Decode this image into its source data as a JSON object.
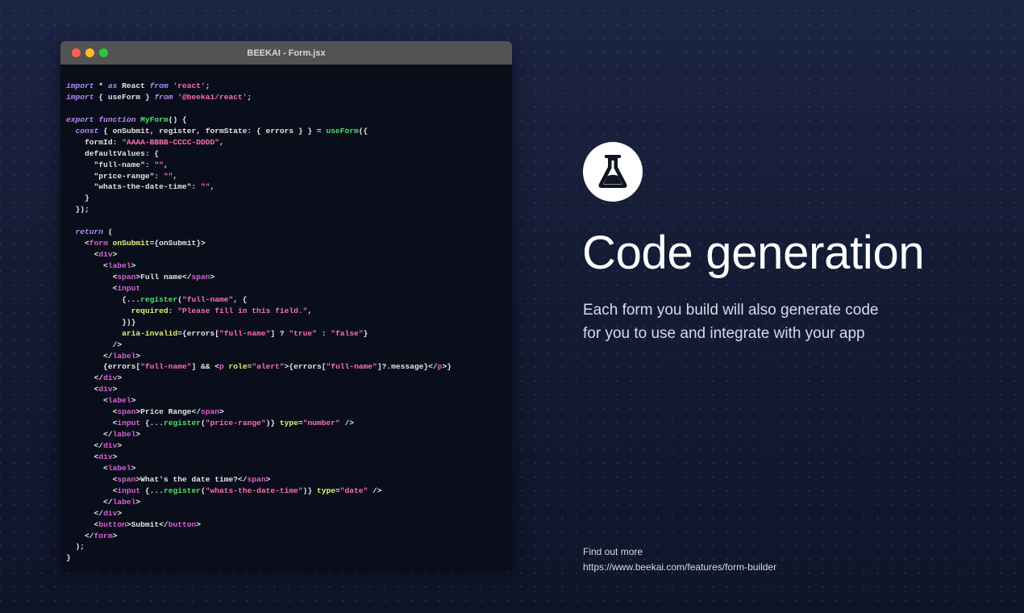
{
  "window": {
    "title": "BEEKAI - Form.jsx",
    "code_lines": [
      [
        [
          "kw",
          "import"
        ],
        [
          "pl",
          " * "
        ],
        [
          "kw",
          "as"
        ],
        [
          "pl",
          " React "
        ],
        [
          "kw",
          "from"
        ],
        [
          "pl",
          " "
        ],
        [
          "str",
          "'react'"
        ],
        [
          "pl",
          ";"
        ]
      ],
      [
        [
          "kw",
          "import"
        ],
        [
          "pl",
          " { useForm } "
        ],
        [
          "kw",
          "from"
        ],
        [
          "pl",
          " "
        ],
        [
          "str",
          "'@beekai/react'"
        ],
        [
          "pl",
          ";"
        ]
      ],
      [],
      [
        [
          "kw",
          "export"
        ],
        [
          "pl",
          " "
        ],
        [
          "kw",
          "function"
        ],
        [
          "pl",
          " "
        ],
        [
          "fn",
          "MyForm"
        ],
        [
          "pl",
          "() {"
        ]
      ],
      [
        [
          "pl",
          "  "
        ],
        [
          "kw",
          "const"
        ],
        [
          "pl",
          " { onSubmit, register, formState: { errors } } = "
        ],
        [
          "fn",
          "useForm"
        ],
        [
          "pl",
          "({"
        ]
      ],
      [
        [
          "pl",
          "    formId: "
        ],
        [
          "str",
          "\"AAAA-BBBB-CCCC-DDDD\""
        ],
        [
          "pl",
          ","
        ]
      ],
      [
        [
          "pl",
          "    defaultValues: {"
        ]
      ],
      [
        [
          "pl",
          "      \"full-name\": "
        ],
        [
          "str",
          "\"\""
        ],
        [
          "pl",
          ","
        ]
      ],
      [
        [
          "pl",
          "      \"price-range\": "
        ],
        [
          "str",
          "\"\""
        ],
        [
          "pl",
          ","
        ]
      ],
      [
        [
          "pl",
          "      \"whats-the-date-time\": "
        ],
        [
          "str",
          "\"\""
        ],
        [
          "pl",
          ","
        ]
      ],
      [
        [
          "pl",
          "    }"
        ]
      ],
      [
        [
          "pl",
          "  });"
        ]
      ],
      [],
      [
        [
          "pl",
          "  "
        ],
        [
          "kw",
          "return"
        ],
        [
          "pl",
          " ("
        ]
      ],
      [
        [
          "pl",
          "    <"
        ],
        [
          "tag",
          "form"
        ],
        [
          "pl",
          " "
        ],
        [
          "attr",
          "onSubmit"
        ],
        [
          "pl",
          "={onSubmit}>"
        ]
      ],
      [
        [
          "pl",
          "      <"
        ],
        [
          "tag",
          "div"
        ],
        [
          "pl",
          ">"
        ]
      ],
      [
        [
          "pl",
          "        <"
        ],
        [
          "tag",
          "label"
        ],
        [
          "pl",
          ">"
        ]
      ],
      [
        [
          "pl",
          "          <"
        ],
        [
          "tag",
          "span"
        ],
        [
          "pl",
          ">Full name</"
        ],
        [
          "tag",
          "span"
        ],
        [
          "pl",
          ">"
        ]
      ],
      [
        [
          "pl",
          "          <"
        ],
        [
          "tag",
          "input"
        ]
      ],
      [
        [
          "pl",
          "            {..."
        ],
        [
          "fn",
          "register"
        ],
        [
          "pl",
          "("
        ],
        [
          "str",
          "\"full-name\""
        ],
        [
          "pl",
          ", {"
        ]
      ],
      [
        [
          "pl",
          "              "
        ],
        [
          "attr",
          "required"
        ],
        [
          "pl",
          ": "
        ],
        [
          "str",
          "\"Please fill in this field.\""
        ],
        [
          "pl",
          ","
        ]
      ],
      [
        [
          "pl",
          "            })}"
        ]
      ],
      [
        [
          "pl",
          "            "
        ],
        [
          "attr",
          "aria-invalid"
        ],
        [
          "pl",
          "={errors["
        ],
        [
          "str",
          "\"full-name\""
        ],
        [
          "pl",
          "] ? "
        ],
        [
          "str",
          "\"true\""
        ],
        [
          "pl",
          " : "
        ],
        [
          "str",
          "\"false\""
        ],
        [
          "pl",
          "}"
        ]
      ],
      [
        [
          "pl",
          "          />"
        ]
      ],
      [
        [
          "pl",
          "        </"
        ],
        [
          "tag",
          "label"
        ],
        [
          "pl",
          ">"
        ]
      ],
      [
        [
          "pl",
          "        {errors["
        ],
        [
          "str",
          "\"full-name\""
        ],
        [
          "pl",
          "] && <"
        ],
        [
          "tag",
          "p"
        ],
        [
          "pl",
          " "
        ],
        [
          "attr",
          "role"
        ],
        [
          "pl",
          "="
        ],
        [
          "str",
          "\"alert\""
        ],
        [
          "pl",
          ">{errors["
        ],
        [
          "str",
          "\"full-name\""
        ],
        [
          "pl",
          "]?.message}</"
        ],
        [
          "tag",
          "p"
        ],
        [
          "pl",
          ">}"
        ]
      ],
      [
        [
          "pl",
          "      </"
        ],
        [
          "tag",
          "div"
        ],
        [
          "pl",
          ">"
        ]
      ],
      [
        [
          "pl",
          "      <"
        ],
        [
          "tag",
          "div"
        ],
        [
          "pl",
          ">"
        ]
      ],
      [
        [
          "pl",
          "        <"
        ],
        [
          "tag",
          "label"
        ],
        [
          "pl",
          ">"
        ]
      ],
      [
        [
          "pl",
          "          <"
        ],
        [
          "tag",
          "span"
        ],
        [
          "pl",
          ">Price Range</"
        ],
        [
          "tag",
          "span"
        ],
        [
          "pl",
          ">"
        ]
      ],
      [
        [
          "pl",
          "          <"
        ],
        [
          "tag",
          "input"
        ],
        [
          "pl",
          " {..."
        ],
        [
          "fn",
          "register"
        ],
        [
          "pl",
          "("
        ],
        [
          "str",
          "\"price-range\""
        ],
        [
          "pl",
          ")} "
        ],
        [
          "attr",
          "type"
        ],
        [
          "pl",
          "="
        ],
        [
          "str",
          "\"number\""
        ],
        [
          "pl",
          " />"
        ]
      ],
      [
        [
          "pl",
          "        </"
        ],
        [
          "tag",
          "label"
        ],
        [
          "pl",
          ">"
        ]
      ],
      [
        [
          "pl",
          "      </"
        ],
        [
          "tag",
          "div"
        ],
        [
          "pl",
          ">"
        ]
      ],
      [
        [
          "pl",
          "      <"
        ],
        [
          "tag",
          "div"
        ],
        [
          "pl",
          ">"
        ]
      ],
      [
        [
          "pl",
          "        <"
        ],
        [
          "tag",
          "label"
        ],
        [
          "pl",
          ">"
        ]
      ],
      [
        [
          "pl",
          "          <"
        ],
        [
          "tag",
          "span"
        ],
        [
          "pl",
          ">What's the date time?</"
        ],
        [
          "tag",
          "span"
        ],
        [
          "pl",
          ">"
        ]
      ],
      [
        [
          "pl",
          "          <"
        ],
        [
          "tag",
          "input"
        ],
        [
          "pl",
          " {..."
        ],
        [
          "fn",
          "register"
        ],
        [
          "pl",
          "("
        ],
        [
          "str",
          "\"whats-the-date-time\""
        ],
        [
          "pl",
          ")} "
        ],
        [
          "attr",
          "type"
        ],
        [
          "pl",
          "="
        ],
        [
          "str",
          "\"date\""
        ],
        [
          "pl",
          " />"
        ]
      ],
      [
        [
          "pl",
          "        </"
        ],
        [
          "tag",
          "label"
        ],
        [
          "pl",
          ">"
        ]
      ],
      [
        [
          "pl",
          "      </"
        ],
        [
          "tag",
          "div"
        ],
        [
          "pl",
          ">"
        ]
      ],
      [
        [
          "pl",
          "      <"
        ],
        [
          "tag",
          "button"
        ],
        [
          "pl",
          ">Submit</"
        ],
        [
          "tag",
          "button"
        ],
        [
          "pl",
          ">"
        ]
      ],
      [
        [
          "pl",
          "    </"
        ],
        [
          "tag",
          "form"
        ],
        [
          "pl",
          ">"
        ]
      ],
      [
        [
          "pl",
          "  );"
        ]
      ],
      [
        [
          "pl",
          "}"
        ]
      ]
    ]
  },
  "feature": {
    "icon": "flask-icon",
    "title": "Code generation",
    "description_line1": "Each form you build will also generate code",
    "description_line2": "for you to use and integrate with your app"
  },
  "footer": {
    "label": "Find out more",
    "url": "https://www.beekai.com/features/form-builder"
  },
  "colors": {
    "keyword": "#b48af5",
    "string": "#ff6fb1",
    "function": "#4be36a",
    "tag": "#e05fd8",
    "attribute": "#e8f07a",
    "plain": "#e6e6e6",
    "background": "#141b33"
  }
}
